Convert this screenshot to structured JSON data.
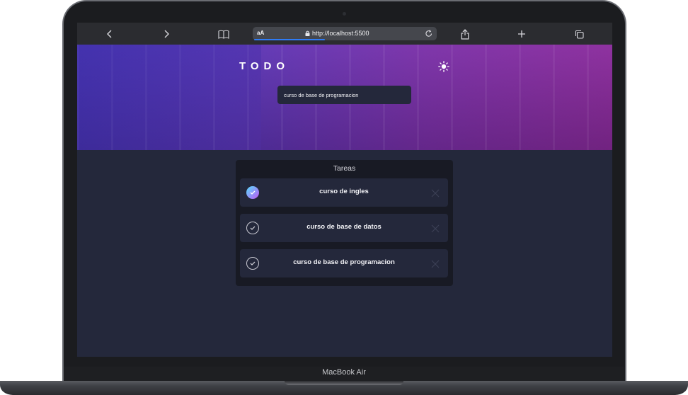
{
  "browser": {
    "url_aa": "aA",
    "url": "http://localhost:5500"
  },
  "app": {
    "title": "TODO",
    "new_task_value": "curso de base de programacion",
    "list_title": "Tareas",
    "tasks": [
      {
        "label": "curso de ingles",
        "completed": true
      },
      {
        "label": "curso de base de datos",
        "completed": false
      },
      {
        "label": "curso de base de programacion",
        "completed": false
      }
    ]
  },
  "device": {
    "label": "MacBook Air"
  },
  "colors": {
    "background": "#24283b",
    "card": "#181a24",
    "check_gradient_start": "#57ddff",
    "check_gradient_end": "#c058f3"
  }
}
